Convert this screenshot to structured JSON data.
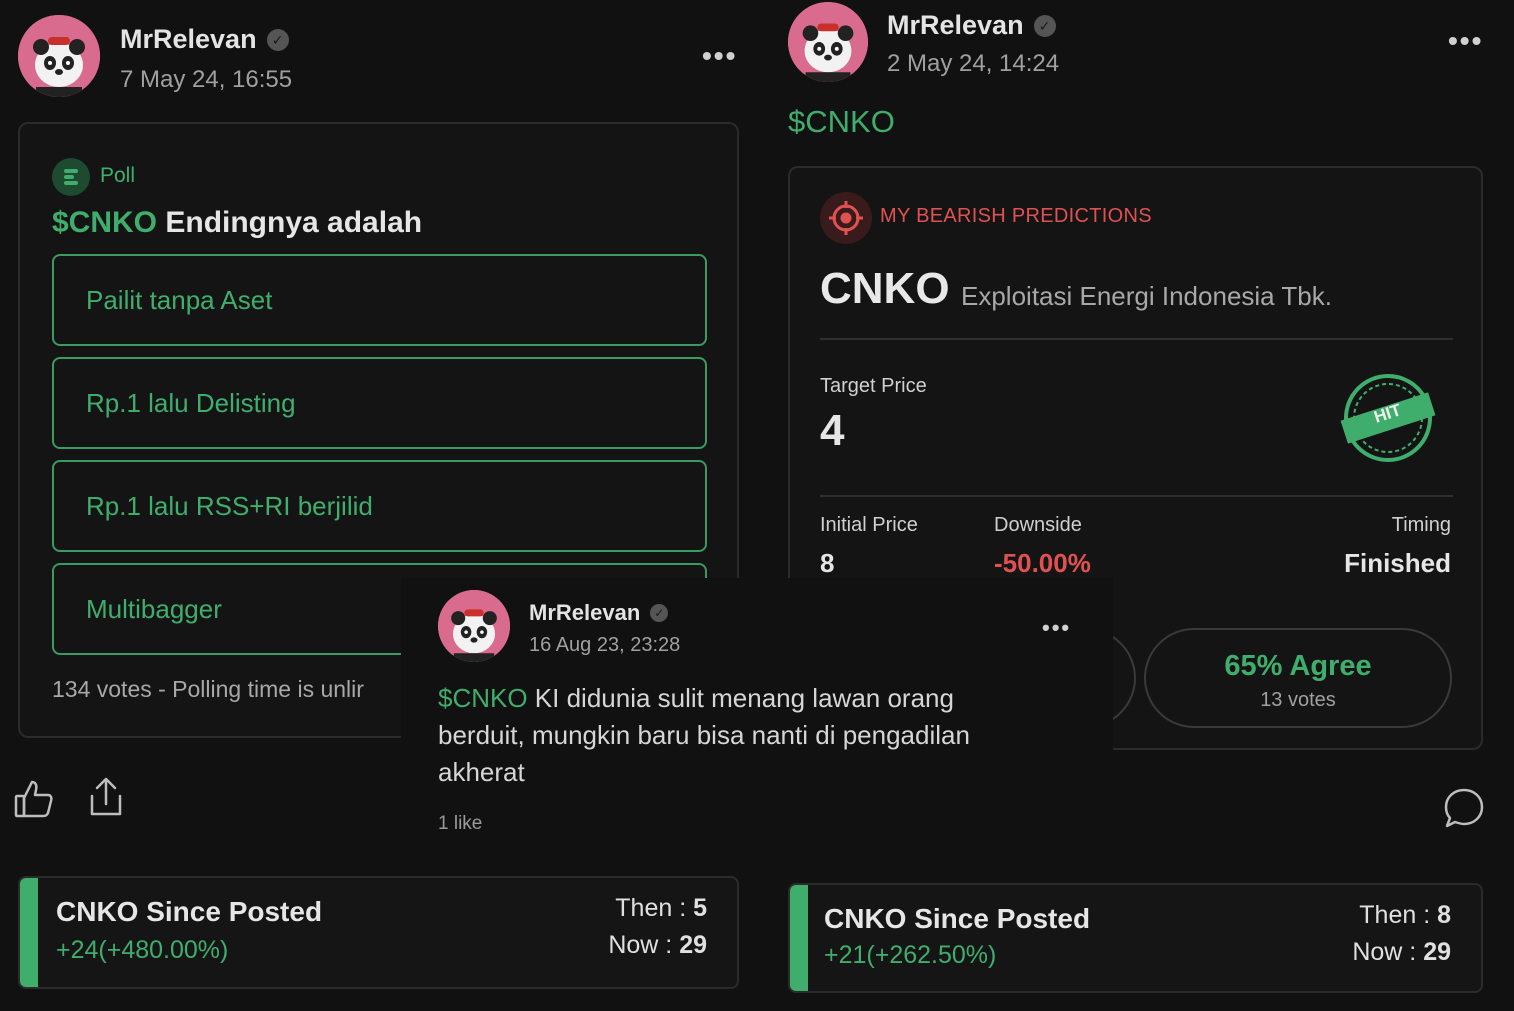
{
  "left_post": {
    "username": "MrRelevan",
    "date": "7 May 24, 16:55",
    "poll": {
      "tag": "Poll",
      "ticker": "$CNKO",
      "question": "Endingnya adalah",
      "options": [
        "Pailit tanpa Aset",
        "Rp.1 lalu Delisting",
        "Rp.1 lalu RSS+RI berjilid",
        "Multibagger"
      ],
      "footer": "134 votes - Polling time is unlir"
    },
    "since": {
      "title": "CNKO Since Posted",
      "change": "+24(+480.00%)",
      "then_label": "Then : ",
      "then_value": "5",
      "now_label": "Now : ",
      "now_value": "29"
    }
  },
  "right_post": {
    "username": "MrRelevan",
    "date": "2 May 24, 14:24",
    "ticker": "$CNKO",
    "prediction": {
      "badge": "MY BEARISH PREDICTIONS",
      "code": "CNKO",
      "company": "Exploitasi Energi Indonesia Tbk.",
      "target_label": "Target Price",
      "target_value": "4",
      "stamp": "HIT",
      "initial_label": "Initial Price",
      "initial_value": "8",
      "downside_label": "Downside",
      "downside_value": "-50.00%",
      "timing_label": "Timing",
      "timing_value": "Finished",
      "agree_label": "65% Agree",
      "agree_votes": "13 votes"
    },
    "since": {
      "title": "CNKO Since Posted",
      "change": "+21(+262.50%)",
      "then_label": "Then : ",
      "then_value": "8",
      "now_label": "Now : ",
      "now_value": "29"
    }
  },
  "middle_post": {
    "username": "MrRelevan",
    "date": "16 Aug 23, 23:28",
    "ticker": "$CNKO",
    "text_line1": " KI didunia sulit menang lawan orang",
    "text_line2": "berduit, mungkin baru bisa nanti di pengadilan",
    "text_line3": "akherat",
    "likes": "1 like"
  },
  "icons": {
    "more": "more-dots-icon",
    "like": "thumbs-up-icon",
    "share": "share-icon",
    "comment": "comment-icon",
    "verified": "verified-check-icon",
    "poll": "poll-icon",
    "target": "target-icon"
  },
  "colors": {
    "green": "#3fae6d",
    "red": "#e05252",
    "background": "#111111"
  }
}
